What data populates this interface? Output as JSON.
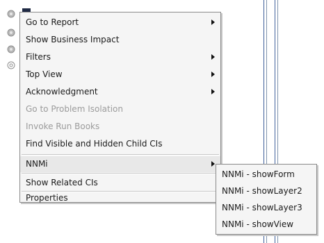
{
  "background": {
    "icons": [
      "gear-icon",
      "gear-icon",
      "gear-icon",
      "gear-outline-icon"
    ]
  },
  "menu": {
    "items": [
      {
        "label": "Go to Report",
        "submenu": true,
        "enabled": true
      },
      {
        "label": "Show Business Impact",
        "submenu": false,
        "enabled": true
      },
      {
        "label": "Filters",
        "submenu": true,
        "enabled": true
      },
      {
        "label": "Top View",
        "submenu": true,
        "enabled": true
      },
      {
        "label": "Acknowledgment",
        "submenu": true,
        "enabled": true
      },
      {
        "label": "Go to Problem Isolation",
        "submenu": false,
        "enabled": false
      },
      {
        "label": "Invoke Run Books",
        "submenu": false,
        "enabled": false
      },
      {
        "label": "Find Visible and Hidden Child CIs",
        "submenu": false,
        "enabled": true
      },
      {
        "label": "NNMi",
        "submenu": true,
        "enabled": true,
        "active": true
      },
      {
        "label": "Show Related CIs",
        "submenu": false,
        "enabled": true
      },
      {
        "label": "Properties",
        "submenu": false,
        "enabled": true
      }
    ]
  },
  "submenu": {
    "items": [
      {
        "label": "NNMi - showForm"
      },
      {
        "label": "NNMi - showLayer2"
      },
      {
        "label": "NNMi - showLayer3"
      },
      {
        "label": "NNMi - showView"
      }
    ]
  },
  "colors": {
    "menu_bg": "#f5f5f5",
    "border": "#8a8a8a",
    "disabled_text": "#9b9b9b",
    "line_blue": "#3d5f9a"
  }
}
